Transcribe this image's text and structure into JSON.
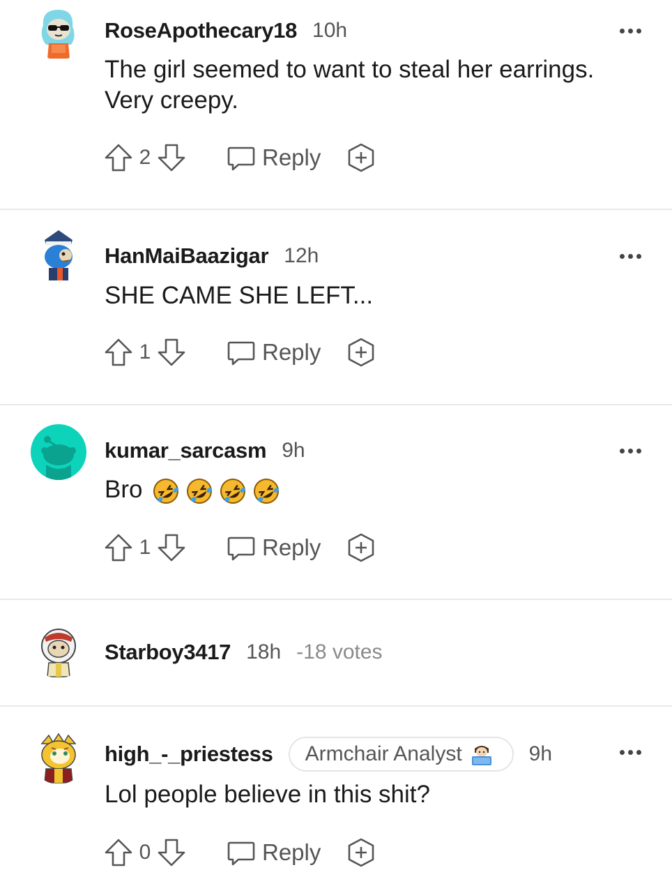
{
  "comments": [
    {
      "username": "RoseApothecary18",
      "time": "10h",
      "body": [
        "The girl seemed to want to steal her earrings.",
        "Very creepy."
      ],
      "score": "2",
      "reply_label": "Reply",
      "avatar_icon": "snoo-avatar-sunglasses"
    },
    {
      "username": "HanMaiBaazigar",
      "time": "12h",
      "body": [
        "SHE CAME SHE LEFT..."
      ],
      "score": "1",
      "reply_label": "Reply",
      "avatar_icon": "snoo-avatar-captain-hat"
    },
    {
      "username": "kumar_sarcasm",
      "time": "9h",
      "body": [
        "Bro"
      ],
      "emojis": [
        "rofl-emoji",
        "rofl-emoji",
        "rofl-emoji",
        "rofl-emoji"
      ],
      "score": "1",
      "reply_label": "Reply",
      "avatar_icon": "default-snoo-avatar"
    },
    {
      "username": "Starboy3417",
      "time": "18h",
      "votes_note": "-18 votes",
      "collapsed": true,
      "avatar_icon": "snoo-avatar-parka"
    },
    {
      "username": "high_-_priestess",
      "flair": "Armchair Analyst",
      "flair_emoji": "technologist-emoji",
      "time": "9h",
      "body": [
        "Lol people believe in this shit?"
      ],
      "score": "0",
      "reply_label": "Reply",
      "avatar_icon": "snoo-avatar-tiger"
    }
  ],
  "colors": {
    "text": "#1a1a1b",
    "meta": "#555555",
    "divider": "#e9e9e9",
    "default_avatar_bg": "#0dd3bb"
  }
}
